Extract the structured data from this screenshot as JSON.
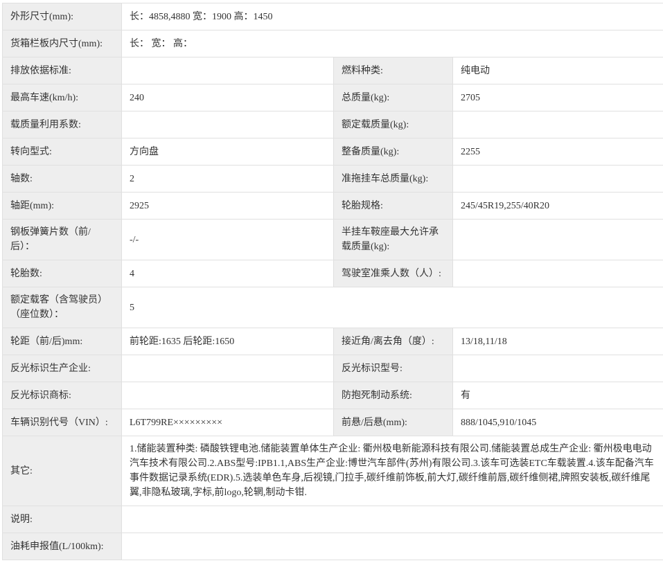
{
  "colors": {
    "label_bg": "#eeeeee",
    "cell_bg": "#ffffff",
    "border": "#e0e0e0",
    "text": "#333333"
  },
  "table": {
    "rows": [
      {
        "label": "外形尺寸(mm):",
        "value": "长：4858,4880 宽：1900 高：1450"
      },
      {
        "label": "货箱栏板内尺寸(mm):",
        "value": "长： 宽： 高："
      },
      {
        "label1": "排放依据标准:",
        "value1": "",
        "label2": "燃料种类:",
        "value2": "纯电动"
      },
      {
        "label1": "最高车速(km/h):",
        "value1": "240",
        "label2": "总质量(kg):",
        "value2": "2705"
      },
      {
        "label1": "载质量利用系数:",
        "value1": "",
        "label2": "额定载质量(kg):",
        "value2": ""
      },
      {
        "label1": "转向型式:",
        "value1": "方向盘",
        "label2": "整备质量(kg):",
        "value2": "2255"
      },
      {
        "label1": "轴数:",
        "value1": "2",
        "label2": "准拖挂车总质量(kg):",
        "value2": ""
      },
      {
        "label1": "轴距(mm):",
        "value1": "2925",
        "label2": "轮胎规格:",
        "value2": "245/45R19,255/40R20"
      },
      {
        "label1": "钢板弹簧片数（前/后）：",
        "value1": "-/-",
        "label2": "半挂车鞍座最大允许承载质量(kg):",
        "value2": ""
      },
      {
        "label1": "轮胎数:",
        "value1": "4",
        "label2": "驾驶室准乘人数（人）:",
        "value2": ""
      },
      {
        "label": "额定载客（含驾驶员）（座位数）：",
        "value": "5"
      },
      {
        "label1": "轮距（前/后)mm:",
        "value1": "前轮距:1635 后轮距:1650",
        "label2": "接近角/离去角（度）:",
        "value2": "13/18,11/18"
      },
      {
        "label1": "反光标识生产企业:",
        "value1": "",
        "label2": "反光标识型号:",
        "value2": ""
      },
      {
        "label1": "反光标识商标:",
        "value1": "",
        "label2": "防抱死制动系统:",
        "value2": "有"
      },
      {
        "label1": "车辆识别代号（VIN）:",
        "value1": "L6T799RE×××××××××",
        "label2": "前悬/后悬(mm):",
        "value2": "888/1045,910/1045"
      },
      {
        "label": "其它:",
        "value": "1.储能装置种类: 磷酸铁锂电池.储能装置单体生产企业: 衢州极电新能源科技有限公司.储能装置总成生产企业: 衢州极电电动汽车技术有限公司.2.ABS型号:IPB1.1,ABS生产企业:博世汽车部件(苏州)有限公司.3.该车可选装ETC车载装置.4.该车配备汽车事件数据记录系统(EDR).5.选装单色车身,后视镜,门拉手,碳纤维前饰板,前大灯,碳纤维前唇,碳纤维侧裙,牌照安装板,碳纤维尾翼,非隐私玻璃,字标,前logo,轮辋,制动卡钳."
      },
      {
        "label": "说明:",
        "value": ""
      },
      {
        "label": "油耗申报值(L/100km):",
        "value": ""
      }
    ]
  }
}
